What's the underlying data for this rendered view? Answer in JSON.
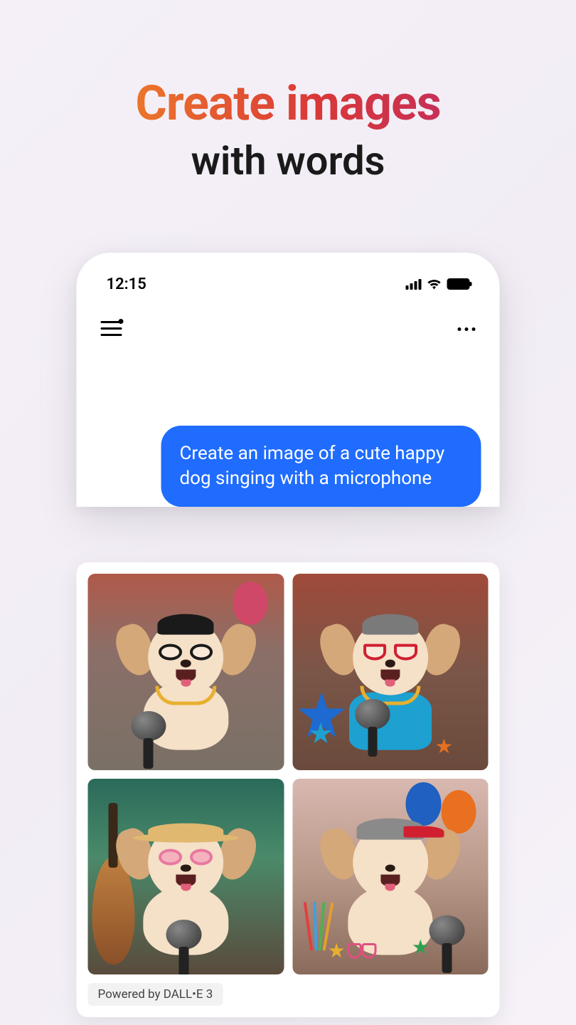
{
  "hero": {
    "line1": "Create images",
    "line2": "with words"
  },
  "status": {
    "time": "12:15"
  },
  "chat": {
    "user_message": "Create an image of a cute happy dog singing with a microphone"
  },
  "footer": {
    "powered_by": "Powered by DALL•E 3"
  },
  "images": [
    {
      "alt": "Dog with black cap, glasses, gold chain and microphone"
    },
    {
      "alt": "Dog with grey cap, red sunglasses, blue shirt, gold chain, studio microphone and star guitar"
    },
    {
      "alt": "Dog with straw hat, pink round glasses, floral collar and microphone with guitar behind"
    },
    {
      "alt": "Dog with grey and red cap, microphone, pencils cup, balloons"
    }
  ]
}
